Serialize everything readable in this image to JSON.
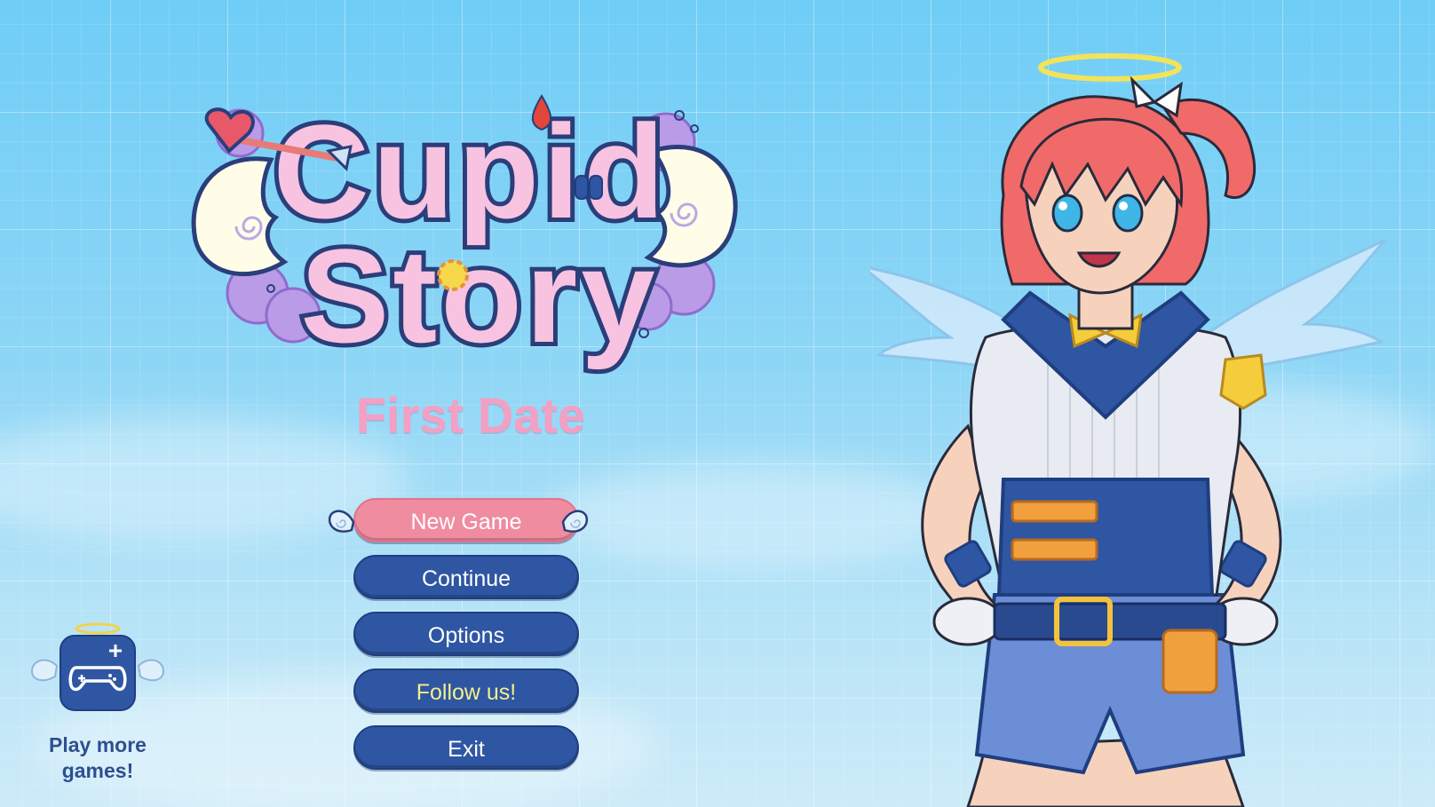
{
  "game": {
    "logo_line1": "Cupid",
    "logo_line2": "Story",
    "subtitle": "First Date"
  },
  "menu": {
    "items": [
      {
        "label": "New Game",
        "state": "selected"
      },
      {
        "label": "Continue",
        "state": "normal"
      },
      {
        "label": "Options",
        "state": "normal"
      },
      {
        "label": "Follow us!",
        "state": "highlight"
      },
      {
        "label": "Exit",
        "state": "normal"
      }
    ]
  },
  "more_games": {
    "label_line1": "Play more",
    "label_line2": "games!",
    "icon": "gamepad-plus-icon"
  },
  "colors": {
    "sky": "#8ed6f6",
    "button": "#2f56a2",
    "button_selected": "#f08ca0",
    "subtitle": "#f3a0c4",
    "follow_text": "#f1f08e",
    "more_games_text": "#2e4f8f"
  }
}
